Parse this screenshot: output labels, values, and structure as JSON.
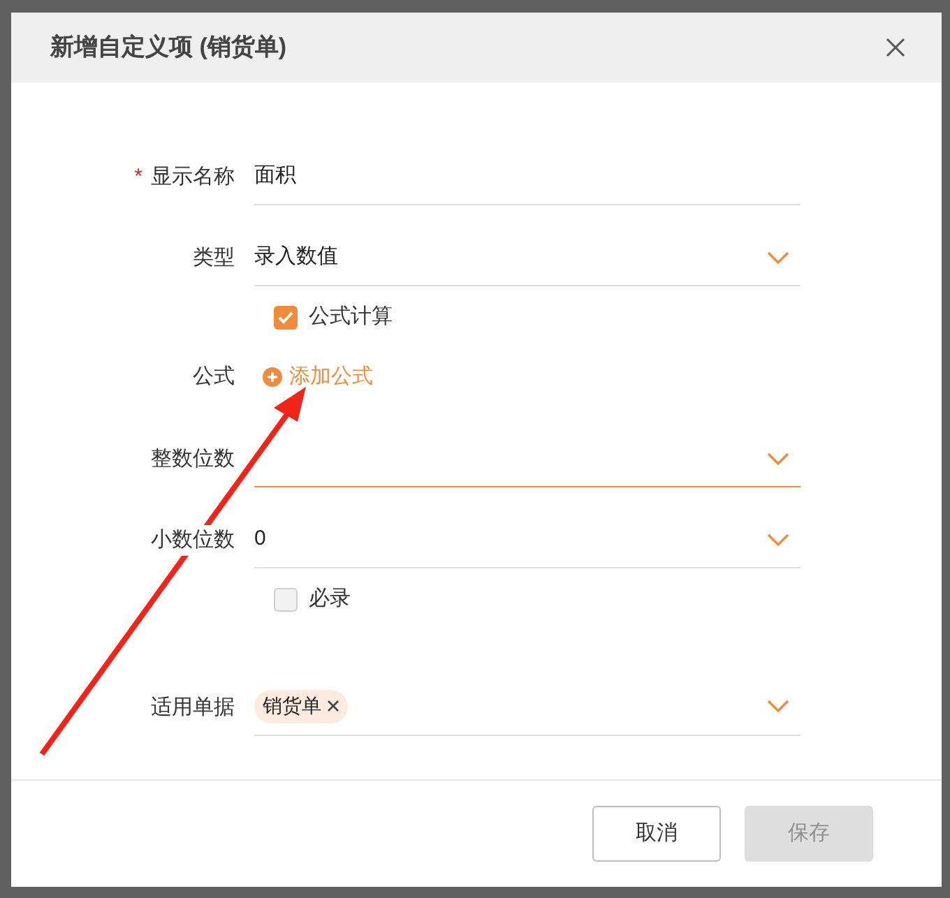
{
  "dialog": {
    "title": "新增自定义项 (销货单)"
  },
  "fields": [
    {
      "kind": "text",
      "label": "显示名称",
      "required_mark": "*",
      "value": "面积",
      "focused": false
    },
    {
      "kind": "select",
      "label": "类型",
      "value": "录入数值",
      "focused": false
    },
    {
      "kind": "checkbox",
      "label": "公式计算",
      "checked": true
    },
    {
      "kind": "link",
      "label": "公式",
      "link": "添加公式"
    },
    {
      "kind": "select",
      "label": "整数位数",
      "focused": true
    },
    {
      "kind": "select",
      "label": "小数位数",
      "value": "0",
      "focused": false
    },
    {
      "kind": "checkbox",
      "label": "必录",
      "checked": false
    },
    {
      "kind": "tags",
      "label": "适用单据",
      "tags": [
        "销货单"
      ]
    }
  ],
  "buttons": [
    {
      "label": "取消",
      "disabled": false
    },
    {
      "label": "保存",
      "disabled": true
    }
  ]
}
